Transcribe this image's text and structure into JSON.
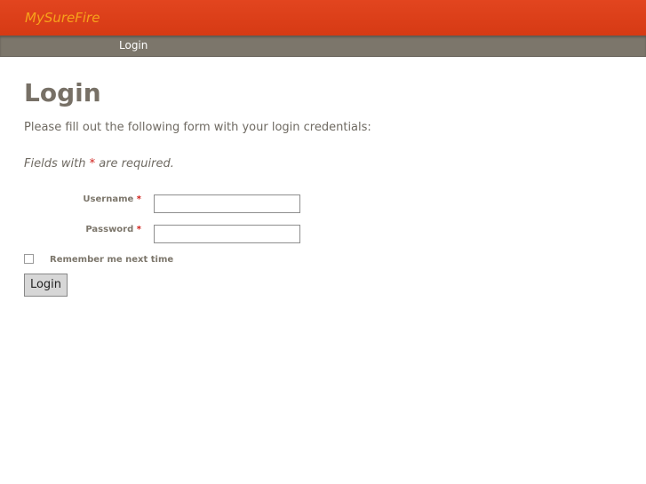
{
  "header": {
    "brand": "MySureFire",
    "colors": {
      "background": "#d93d16",
      "brand_text": "#f7a21b"
    }
  },
  "nav": {
    "items": [
      {
        "label": "Login"
      }
    ],
    "background": "#7c766b"
  },
  "main": {
    "title": "Login",
    "intro": "Please fill out the following form with your login credentials:",
    "required_note_prefix": "Fields with ",
    "required_marker": "*",
    "required_note_suffix": " are required."
  },
  "form": {
    "username": {
      "label": "Username",
      "required_marker": "*",
      "value": ""
    },
    "password": {
      "label": "Password",
      "required_marker": "*",
      "value": ""
    },
    "remember_me": {
      "label": "Remember me next time",
      "checked": false
    },
    "submit_label": "Login"
  }
}
